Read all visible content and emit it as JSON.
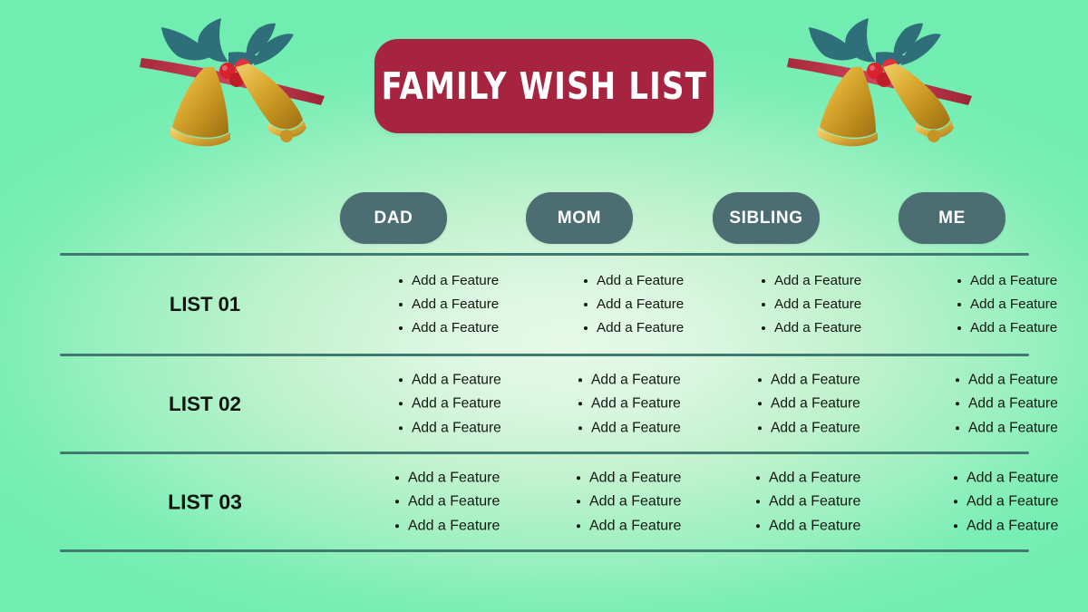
{
  "slide": {
    "title": "Family Wish List",
    "background_outer_color": "#72edb2",
    "background_center_color": "#e6f9e8",
    "title_pill_color": "#a62440",
    "title_text_color": "#ffffff",
    "header_pill_color": "#4c6e73",
    "divider_color": "#3f7b6c",
    "body_text_color": "#121712"
  },
  "decorations": [
    {
      "name": "christmas-bells-left",
      "gold": "#d8a62b",
      "leaf": "#2f6f7a",
      "berry": "#d8232f",
      "ribbon": "#c2384a"
    },
    {
      "name": "christmas-bells-right",
      "gold": "#d8a62b",
      "leaf": "#2f6f7a",
      "berry": "#d8232f",
      "ribbon": "#c2384a"
    }
  ],
  "table": {
    "columns": [
      "DAD",
      "MOM",
      "SIBLING",
      "ME"
    ],
    "rows": [
      {
        "label": "LIST 01",
        "cells": [
          [
            "Add a Feature",
            "Add a Feature",
            "Add a Feature"
          ],
          [
            "Add a Feature",
            "Add a Feature",
            "Add a Feature"
          ],
          [
            "Add a Feature",
            "Add a Feature",
            "Add a Feature"
          ],
          [
            "Add a Feature",
            "Add a Feature",
            "Add a Feature"
          ]
        ]
      },
      {
        "label": "LIST 02",
        "cells": [
          [
            "Add a Feature",
            "Add a Feature",
            "Add a Feature"
          ],
          [
            "Add a Feature",
            "Add a Feature",
            "Add a Feature"
          ],
          [
            "Add a Feature",
            "Add a Feature",
            "Add a Feature"
          ],
          [
            "Add a Feature",
            "Add a Feature",
            "Add a Feature"
          ]
        ]
      },
      {
        "label": "LIST 03",
        "cells": [
          [
            "Add a Feature",
            "Add a Feature",
            "Add a Feature"
          ],
          [
            "Add a Feature",
            "Add a Feature",
            "Add a Feature"
          ],
          [
            "Add a Feature",
            "Add a Feature",
            "Add a Feature"
          ],
          [
            "Add a Feature",
            "Add a Feature",
            "Add a Feature"
          ]
        ]
      }
    ]
  }
}
